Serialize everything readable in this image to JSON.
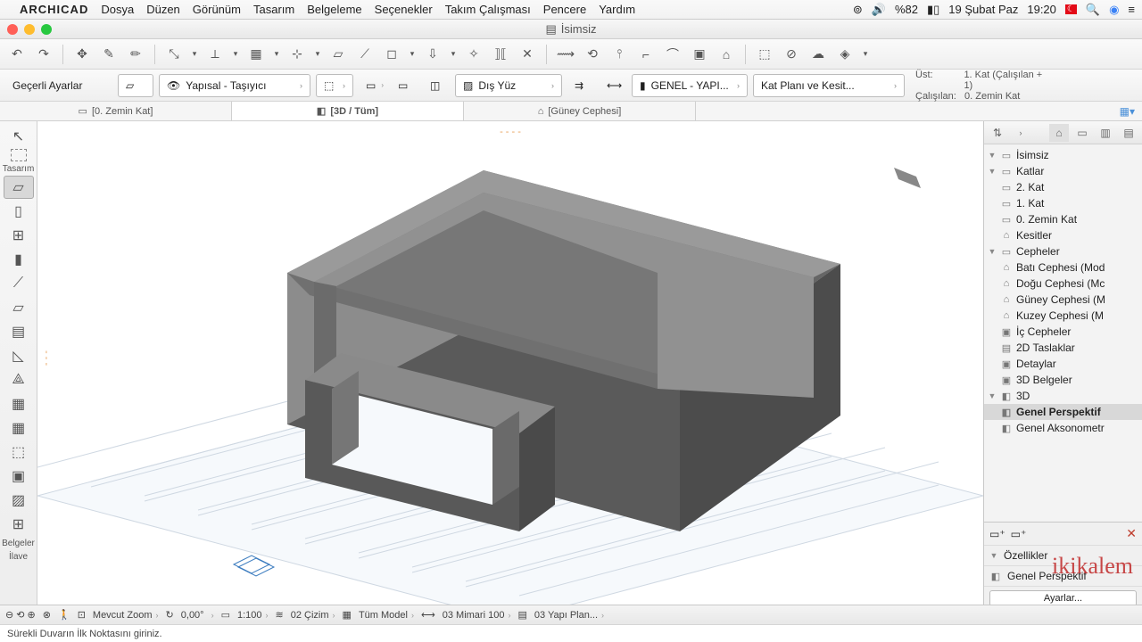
{
  "menubar": {
    "app_name": "ARCHICAD",
    "items": [
      "Dosya",
      "Düzen",
      "Görünüm",
      "Tasarım",
      "Belgeleme",
      "Seçenekler",
      "Takım Çalışması",
      "Pencere",
      "Yardım"
    ],
    "battery": "%82",
    "date": "19 Şubat Paz",
    "time": "19:20"
  },
  "window": {
    "title": "İsimsiz"
  },
  "toolbar2": {
    "current_settings": "Geçerli Ayarlar",
    "layer_label": "Yapısal - Taşıyıcı",
    "surface_label": "Dış Yüz",
    "fill_label": "GENEL - YAPI...",
    "plan_label": "Kat Planı ve Kesit...",
    "story_top_lbl": "Üst:",
    "story_top_val": "1. Kat (Çalışılan + 1)",
    "story_cur_lbl": "Çalışılan:",
    "story_cur_val": "0. Zemin Kat"
  },
  "tabs": {
    "t0": "[0. Zemin Kat]",
    "t1": "[3D / Tüm]",
    "t2": "[Güney Cephesi]"
  },
  "toolbox": {
    "group_design": "Tasarım",
    "group_docs": "Belgeler",
    "group_more": "İlave"
  },
  "navigator": {
    "root": "İsimsiz",
    "stories_group": "Katlar",
    "story2": "2. Kat",
    "story1": "1. Kat",
    "story0": "0. Zemin Kat",
    "sections": "Kesitler",
    "elevations": "Cepheler",
    "elev_w": "Batı Cephesi (Mod",
    "elev_e": "Doğu Cephesi (Mc",
    "elev_s": "Güney Cephesi (M",
    "elev_n": "Kuzey Cephesi (M",
    "interior": "İç Cepheler",
    "drafts": "2D Taslaklar",
    "details": "Detaylar",
    "docs3d": "3D Belgeler",
    "g3d": "3D",
    "persp": "Genel Perspektif",
    "axo": "Genel Aksonometr",
    "props_label": "Özellikler",
    "props_val": "Genel Perspektif",
    "ayarlar": "Ayarlar..."
  },
  "statusbar": {
    "zoom": "Mevcut Zoom",
    "angle": "0,00°",
    "scale": "1:100",
    "layer_combo": "02 Çizim",
    "model_filter": "Tüm Model",
    "dim": "03 Mimari 100",
    "plan": "03 Yapı Plan..."
  },
  "hint": "Sürekli Duvarın İlk Noktasını giriniz.",
  "watermark": "ikikalem"
}
